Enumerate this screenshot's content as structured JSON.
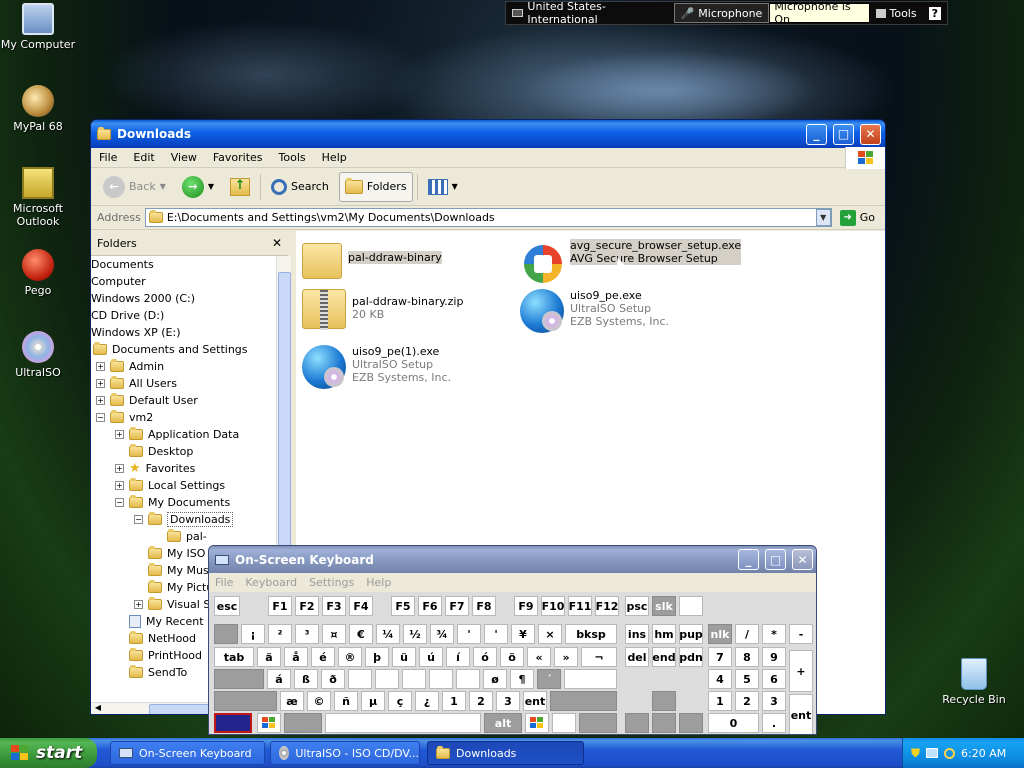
{
  "desktop": {
    "icons": [
      {
        "label": "My Computer"
      },
      {
        "label": "MyPal 68"
      },
      {
        "label": "Microsoft Outlook"
      },
      {
        "label": "Pego"
      },
      {
        "label": "UltraISO"
      },
      {
        "label": "Recycle Bin"
      }
    ]
  },
  "langbar": {
    "language": "United States-International",
    "microphone": "Microphone",
    "mic_status": "Microphone is On",
    "tools": "Tools",
    "help": "?"
  },
  "explorer": {
    "title": "Downloads",
    "menu": [
      "File",
      "Edit",
      "View",
      "Favorites",
      "Tools",
      "Help"
    ],
    "toolbar": {
      "back": "Back",
      "search": "Search",
      "folders": "Folders"
    },
    "address_label": "Address",
    "address": "E:\\Documents and Settings\\vm2\\My Documents\\Downloads",
    "go": "Go",
    "folders_pane_title": "Folders",
    "tree": [
      {
        "label": "Documents"
      },
      {
        "label": "Computer"
      },
      {
        "label": "Windows 2000 (C:)"
      },
      {
        "label": "CD Drive (D:)"
      },
      {
        "label": "Windows XP (E:)"
      },
      {
        "label": "Documents and Settings"
      },
      {
        "label": "Admin"
      },
      {
        "label": "All Users"
      },
      {
        "label": "Default User"
      },
      {
        "label": "vm2"
      },
      {
        "label": "Application Data"
      },
      {
        "label": "Desktop"
      },
      {
        "label": "Favorites"
      },
      {
        "label": "Local Settings"
      },
      {
        "label": "My Documents"
      },
      {
        "label": "Downloads"
      },
      {
        "label": "pal-"
      },
      {
        "label": "My ISO"
      },
      {
        "label": "My Musi"
      },
      {
        "label": "My Pictu"
      },
      {
        "label": "Visual St"
      },
      {
        "label": "My Recent D"
      },
      {
        "label": "NetHood"
      },
      {
        "label": "PrintHood"
      },
      {
        "label": "SendTo"
      }
    ],
    "files": [
      {
        "name": "pal-ddraw-binary",
        "line2": "",
        "line3": ""
      },
      {
        "name": "avg_secure_browser_setup.exe",
        "line2": "AVG Secure Browser Setup",
        "line3": ""
      },
      {
        "name": "pal-ddraw-binary.zip",
        "line2": "20 KB",
        "line3": ""
      },
      {
        "name": "uiso9_pe.exe",
        "line2": "UltraISO Setup",
        "line3": "EZB Systems, Inc."
      },
      {
        "name": "uiso9_pe(1).exe",
        "line2": "UltraISO Setup",
        "line3": "EZB Systems, Inc."
      }
    ]
  },
  "osk": {
    "title": "On-Screen Keyboard",
    "menu": [
      "File",
      "Keyboard",
      "Settings",
      "Help"
    ],
    "keys": {
      "row0": [
        "esc",
        "F1",
        "F2",
        "F3",
        "F4",
        "F5",
        "F6",
        "F7",
        "F8",
        "F9",
        "F10",
        "F11",
        "F12",
        "psc",
        "slk"
      ],
      "row1": [
        "¡",
        "²",
        "³",
        "¤",
        "€",
        "¼",
        "½",
        "¾",
        "'",
        "'",
        "¥",
        "×",
        "bksp",
        "ins",
        "hm",
        "pup",
        "nlk",
        "/",
        "*",
        "-"
      ],
      "row2": [
        "tab",
        "ä",
        "å",
        "é",
        "®",
        "þ",
        "ü",
        "ú",
        "í",
        "ó",
        "ö",
        "«",
        "»",
        "¬",
        "del",
        "end",
        "pdn",
        "7",
        "8",
        "9",
        "+"
      ],
      "row3": [
        "á",
        "ß",
        "ð",
        "ø",
        "¶",
        "´",
        "4",
        "5",
        "6"
      ],
      "row4": [
        "æ",
        "©",
        "ñ",
        "µ",
        "ç",
        "¿",
        "1",
        "2",
        "3",
        "ent"
      ],
      "row5": [
        "alt",
        "0",
        "."
      ]
    }
  },
  "taskbar": {
    "start": "start",
    "tasks": [
      {
        "label": "On-Screen Keyboard"
      },
      {
        "label": "UltraISO - ISO CD/DV..."
      },
      {
        "label": "Downloads"
      }
    ],
    "clock": "6:20 AM"
  }
}
